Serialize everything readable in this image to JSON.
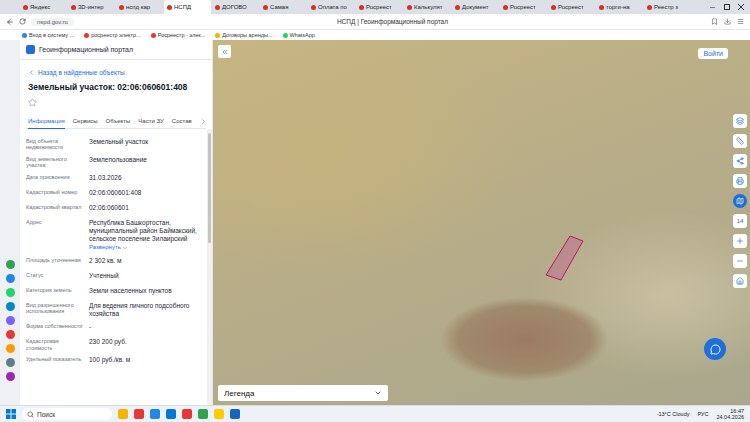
{
  "browser": {
    "tabs": [
      {
        "label": "Яндекс",
        "selected": false
      },
      {
        "label": "3D-интер",
        "selected": false
      },
      {
        "label": "нспд кар",
        "selected": false
      },
      {
        "label": "НСПД",
        "selected": true
      },
      {
        "label": "ДОГОВО",
        "selected": false
      },
      {
        "label": "Самая",
        "selected": false
      },
      {
        "label": "Оплата по",
        "selected": false
      },
      {
        "label": "Росреест",
        "selected": false
      },
      {
        "label": "Калькулят",
        "selected": false
      },
      {
        "label": "Документ",
        "selected": false
      },
      {
        "label": "Росреест",
        "selected": false
      },
      {
        "label": "Росреест",
        "selected": false
      },
      {
        "label": "торги-на",
        "selected": false
      },
      {
        "label": "Реестр з",
        "selected": false
      }
    ],
    "url": "nspd.gov.ru",
    "page_title": "НСПД | Геоинформационный портал",
    "bookmarks": [
      "Вход в систему ...",
      "росреестр электр...",
      "Росреестр - элек...",
      "Договоры аренды...",
      "WhatsApp"
    ]
  },
  "portal": {
    "title": "Геоинформационный портал",
    "back_link": "Назад в найденные объекты",
    "object_title": "Земельный участок: 02:06:060601:408",
    "tabs": [
      {
        "label": "Информация",
        "selected": true
      },
      {
        "label": "Сервисы",
        "selected": false
      },
      {
        "label": "Объекты",
        "selected": false
      },
      {
        "label": "Части ЗУ",
        "selected": false
      },
      {
        "label": "Состав",
        "selected": false
      }
    ],
    "fields": [
      {
        "label": "Вид объекта недвижимости",
        "value": "Земельный участок",
        "link": ""
      },
      {
        "label": "Вид земельного участка",
        "value": "Землепользование",
        "link": ""
      },
      {
        "label": "Дата присвоения",
        "value": "31.03.2026",
        "link": ""
      },
      {
        "label": "Кадастровый номер",
        "value": "02:06:060601:408",
        "link": ""
      },
      {
        "label": "Кадастровый квартал",
        "value": "02:06:060601",
        "link": ""
      },
      {
        "label": "Адрес",
        "value": "Республика Башкортостан, муниципальный район Баймакский, сельское поселение Зилаирский",
        "link": "Развернуть"
      },
      {
        "label": "Площадь уточненная",
        "value": "2 302 кв. м",
        "link": ""
      },
      {
        "label": "Статус",
        "value": "Учтенный",
        "link": ""
      },
      {
        "label": "Категория земель",
        "value": "Земли населенных пунктов",
        "link": ""
      },
      {
        "label": "Вид разрешенного использования",
        "value": "Для ведения личного подсобного хозяйства",
        "link": ""
      },
      {
        "label": "Форма собственности",
        "value": "-",
        "link": ""
      },
      {
        "label": "Кадастровая стоимость",
        "value": "230 200 руб.",
        "link": ""
      },
      {
        "label": "Удельный показатель",
        "value": "100 руб./кв. м",
        "link": ""
      }
    ]
  },
  "map": {
    "login": "Войти",
    "legend": "Легенда",
    "zoom": "14"
  },
  "taskbar": {
    "search": "Поиск",
    "weather": "-13°C Cloudy",
    "lang": "РУС",
    "time": "16:47",
    "date": "24.04.2026"
  }
}
